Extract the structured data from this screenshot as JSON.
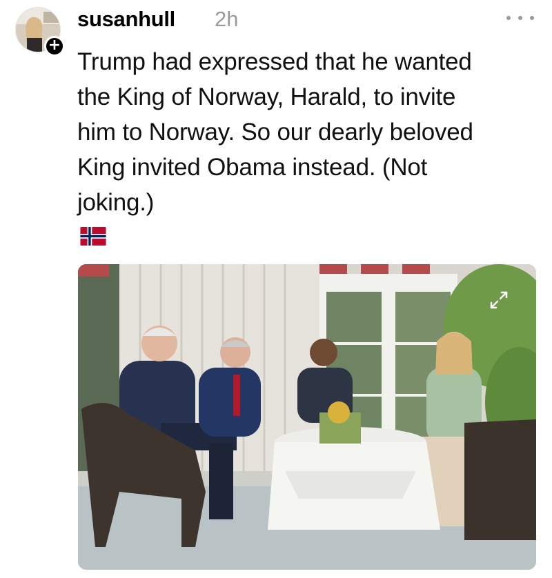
{
  "post": {
    "username": "susanhull",
    "timestamp": "2h",
    "text": "Trump had expressed that he wanted\nthe King of Norway, Harald, to invite\nhim to Norway. So our dearly beloved\nKing invited Obama instead. (Not\njoking.)",
    "flag_emoji": "Norwegian flag"
  },
  "icons": {
    "follow": "+",
    "more": "more-icon",
    "expand": "expand-icon"
  },
  "colors": {
    "timestamp": "#9a9a9a",
    "text": "#111111",
    "flag_red": "#ba0c2f",
    "flag_blue": "#00205b"
  }
}
